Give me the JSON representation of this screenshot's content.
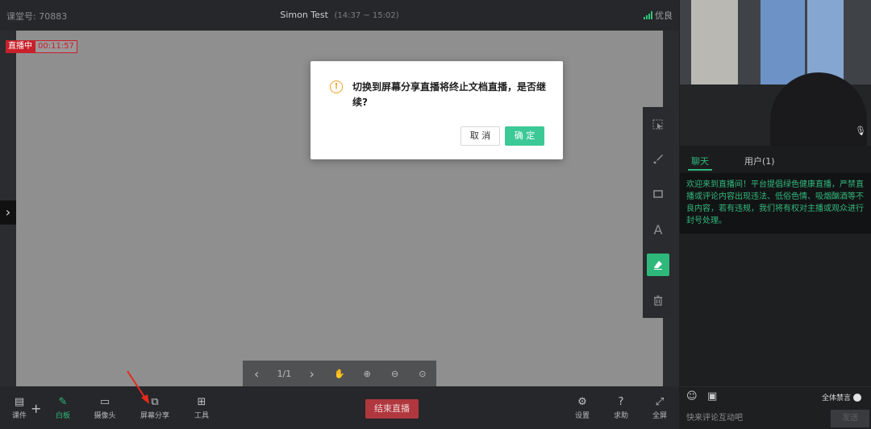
{
  "header": {
    "room_label": "课堂号:",
    "room_id": "70883",
    "title": "Simon Test",
    "time_range": "(14:37 ~ 15:02)",
    "signal_text": "优良",
    "signal_color": "#33c27a"
  },
  "live": {
    "status": "直播中",
    "elapsed": "00:11:57"
  },
  "pagenav": {
    "page": "1/1"
  },
  "toolbar": {
    "items": [
      {
        "label": "课件",
        "icon": "courseware-icon"
      },
      {
        "label": "白板",
        "icon": "whiteboard-icon"
      },
      {
        "label": "摄像头",
        "icon": "camera-icon"
      },
      {
        "label": "屏幕分享",
        "icon": "screen-share-icon"
      },
      {
        "label": "工具",
        "icon": "tools-grid-icon"
      }
    ],
    "end_live": "结束直播",
    "right_items": [
      {
        "label": "设置",
        "icon": "gear-icon"
      },
      {
        "label": "求助",
        "icon": "help-icon"
      },
      {
        "label": "全屏",
        "icon": "fullscreen-icon"
      }
    ]
  },
  "dialog": {
    "message": "切换到屏幕分享直播将终止文档直播，是否继续?",
    "cancel": "取 消",
    "confirm": "确 定"
  },
  "chat": {
    "tab_chat": "聊天",
    "tab_users": "用户(1)",
    "notice": "欢迎来到直播间！平台提倡绿色健康直播，严禁直播或评论内容出现违法、低俗色情、吸烟酗酒等不良内容，若有违规，我们将有权对主播或观众进行封号处理。",
    "mute_all": "全体禁言",
    "input_placeholder": "快来评论互动吧",
    "send": "发送"
  },
  "colors": {
    "accent": "#2fb87c",
    "live_red": "#c8202a",
    "end_live_bg": "#b0373e",
    "warning": "#f0a020"
  }
}
